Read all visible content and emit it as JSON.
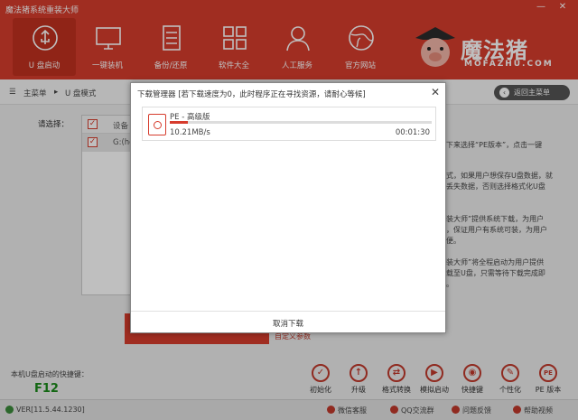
{
  "window": {
    "title": "魔法猪系统重装大师",
    "min": "—",
    "close": "✕"
  },
  "nav": [
    {
      "label": "U 盘启动",
      "icon": "usb-icon"
    },
    {
      "label": "一键装机",
      "icon": "monitor-icon"
    },
    {
      "label": "备份/还原",
      "icon": "backup-icon"
    },
    {
      "label": "软件大全",
      "icon": "apps-grid-icon"
    },
    {
      "label": "人工服务",
      "icon": "person-icon"
    },
    {
      "label": "官方网站",
      "icon": "globe-icon"
    }
  ],
  "logo": {
    "word": "魔法猪",
    "sub": "MOFAZHU.COM"
  },
  "breadcrumb": {
    "home": "主菜单",
    "sep": "▸",
    "current": "U 盘模式"
  },
  "back_button": "返回主菜单",
  "main": {
    "select_label": "请选择：",
    "table_head": "设备",
    "table_row": "G:(hd",
    "right_lines": [
      "下来选择“PE版本”，点击一键",
      "式，如果用户想保存U盘数据，就",
      "丢失数据，否则选择格式化U盘",
      "装大师”提供系统下载，为用户",
      "，保证用户有系统可装，为用户",
      "便。",
      "装大师”将全程启动为用户提供",
      "载至U盘，只需等待下载完成即",
      "。"
    ],
    "custom_params": "自定义参数"
  },
  "hotkey": {
    "label": "本机U盘启动的快捷键：",
    "value": "F12"
  },
  "tools": [
    {
      "label": "初始化",
      "icon": "check-circle-icon",
      "glyph": "✓"
    },
    {
      "label": "升级",
      "icon": "upload-icon",
      "glyph": "↑"
    },
    {
      "label": "格式转换",
      "icon": "convert-icon",
      "glyph": "⇄"
    },
    {
      "label": "模拟启动",
      "icon": "simulate-icon",
      "glyph": "▶"
    },
    {
      "label": "快捷键",
      "icon": "mouse-icon",
      "glyph": "◉"
    },
    {
      "label": "个性化",
      "icon": "palette-icon",
      "glyph": "✎"
    },
    {
      "label": "PE 版本",
      "icon": "pe-icon",
      "glyph": "PE"
    }
  ],
  "status": {
    "version": "VER[11.5.44.1230]",
    "links": [
      "微信客服",
      "QQ交流群",
      "问题反馈",
      "帮助视频"
    ]
  },
  "dialog": {
    "title": "下载管理器 [若下载速度为0，此时程序正在寻找资源，请耐心等候]",
    "close": "✕",
    "item": {
      "name": "PE - 高级版",
      "progress_percent": 7,
      "speed": "10.21MB/s",
      "time": "00:01:30"
    },
    "cancel": "取消下载"
  }
}
